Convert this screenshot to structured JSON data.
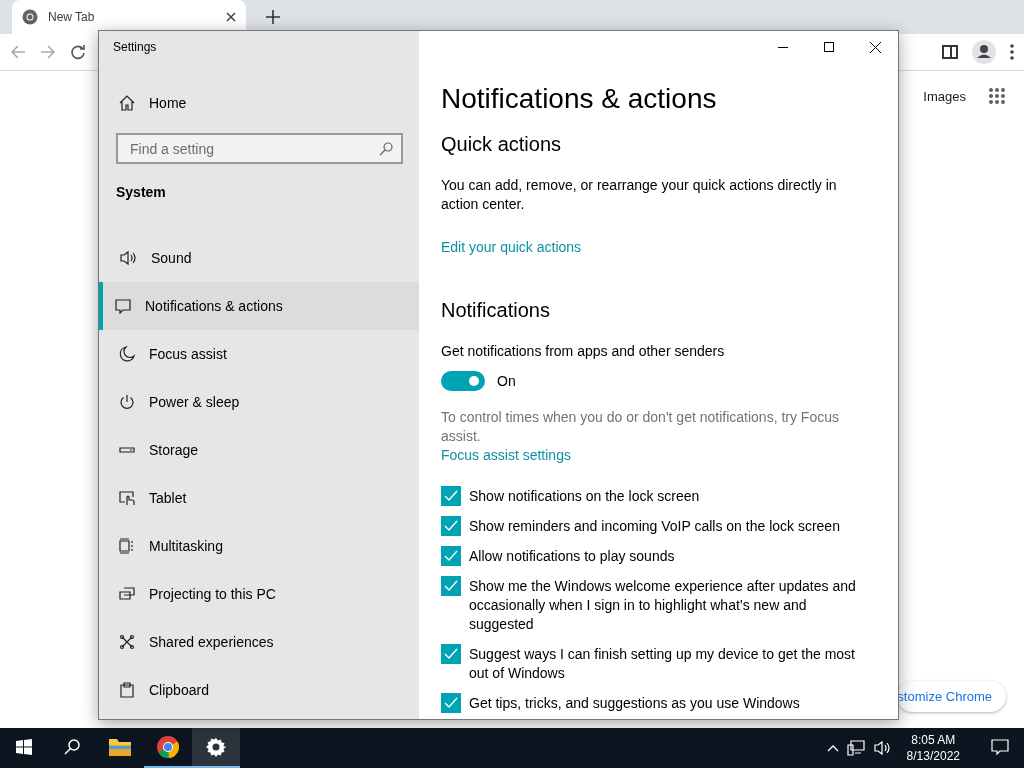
{
  "browser": {
    "tab": {
      "title": "New Tab"
    },
    "page_link": "Images",
    "customize_button": "stomize Chrome"
  },
  "settings": {
    "title": "Settings",
    "home": "Home",
    "search": {
      "placeholder": "Find a setting"
    },
    "section": "System",
    "nav": [
      {
        "label": "Sound",
        "selected": false
      },
      {
        "label": "Notifications & actions",
        "selected": true
      },
      {
        "label": "Focus assist",
        "selected": false
      },
      {
        "label": "Power & sleep",
        "selected": false
      },
      {
        "label": "Storage",
        "selected": false
      },
      {
        "label": "Tablet",
        "selected": false
      },
      {
        "label": "Multitasking",
        "selected": false
      },
      {
        "label": "Projecting to this PC",
        "selected": false
      },
      {
        "label": "Shared experiences",
        "selected": false
      },
      {
        "label": "Clipboard",
        "selected": false
      }
    ],
    "heading": "Notifications & actions",
    "quick_actions": {
      "title": "Quick actions",
      "description": "You can add, remove, or rearrange your quick actions directly in action center.",
      "link": "Edit your quick actions"
    },
    "notifications": {
      "title": "Notifications",
      "toggle_label": "Get notifications from apps and other senders",
      "toggle": {
        "on": true,
        "label": "On"
      },
      "focus_text": "To control times when you do or don't get notifications, try Focus assist.",
      "focus_link": "Focus assist settings",
      "checkboxes": [
        {
          "label": "Show notifications on the lock screen",
          "checked": true
        },
        {
          "label": "Show reminders and incoming VoIP calls on the lock screen",
          "checked": true
        },
        {
          "label": "Allow notifications to play sounds",
          "checked": true
        },
        {
          "label": "Show me the Windows welcome experience after updates and occasionally when I sign in to highlight what’s new and suggested",
          "checked": true
        },
        {
          "label": "Suggest ways I can finish setting up my device to get the most out of Windows",
          "checked": true
        },
        {
          "label": "Get tips, tricks, and suggestions as you use Windows",
          "checked": true
        }
      ]
    }
  },
  "taskbar": {
    "apps": [
      {
        "kind": "explorer",
        "running": false,
        "active": false
      },
      {
        "kind": "chrome",
        "running": true,
        "active": false
      },
      {
        "kind": "settings",
        "running": true,
        "active": true
      }
    ],
    "time": "8:05 AM",
    "date": "8/13/2022"
  }
}
